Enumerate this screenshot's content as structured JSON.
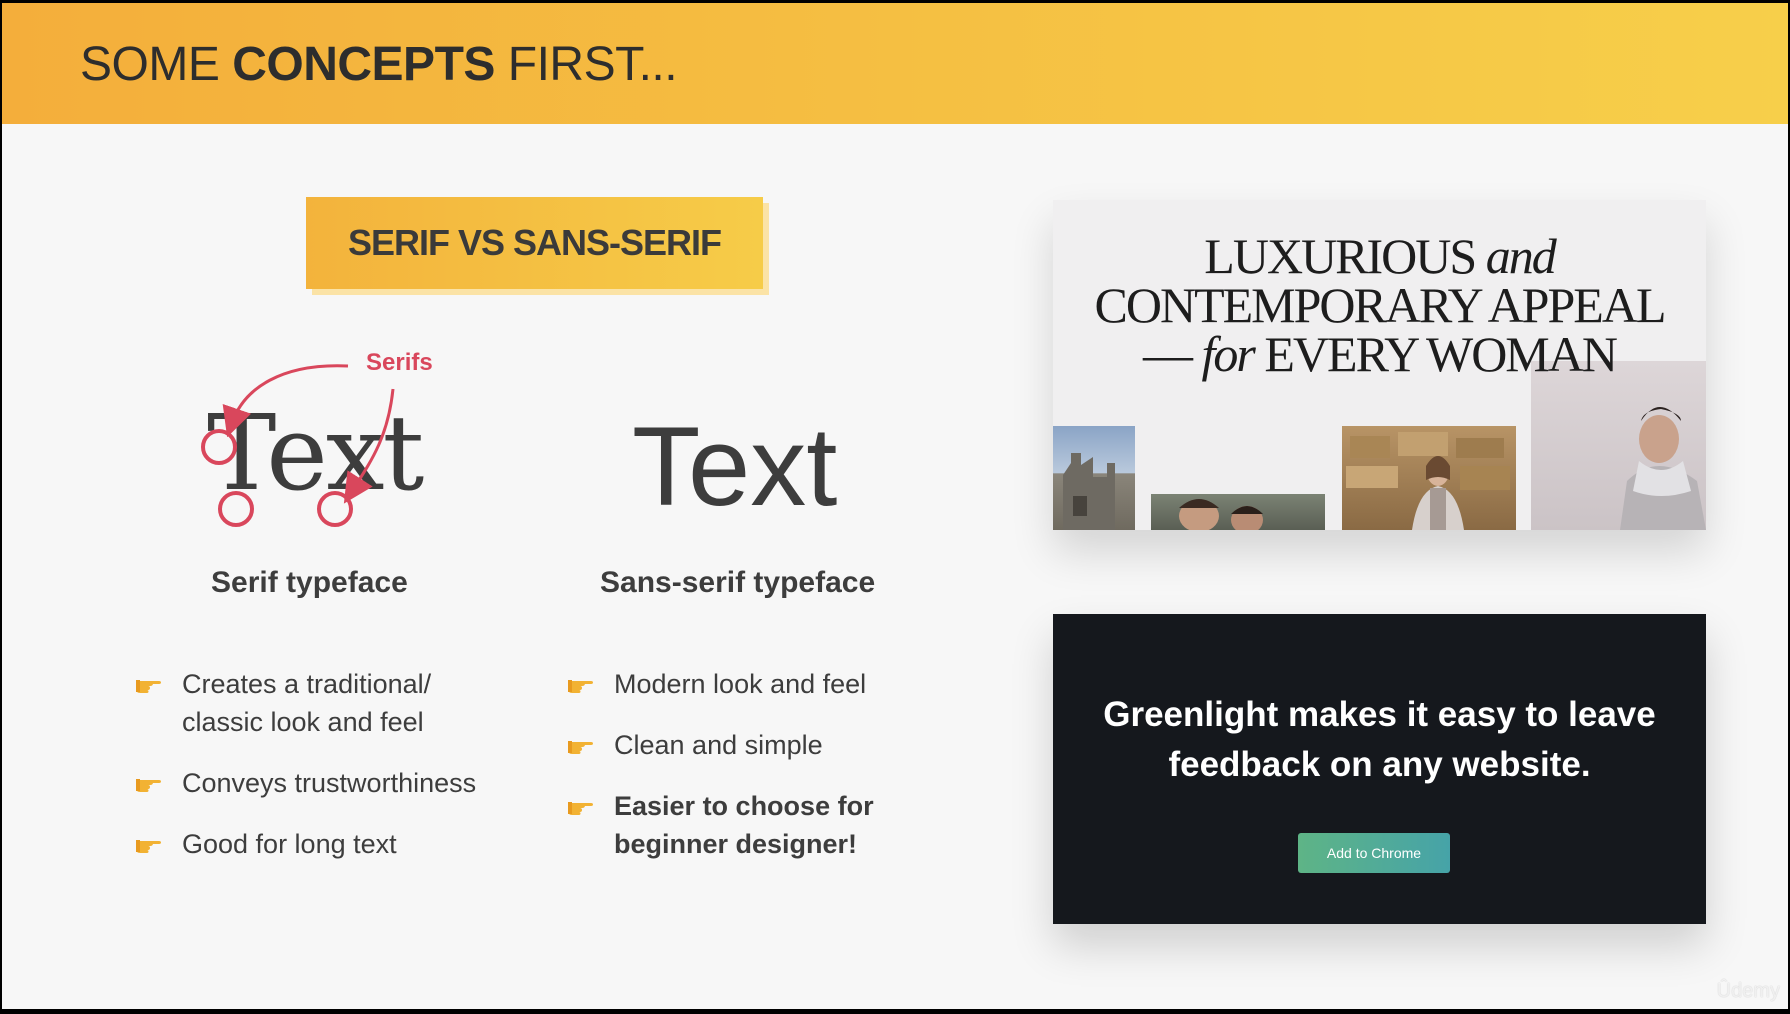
{
  "header": {
    "title_pre": "SOME",
    "title_bold": "CONCEPTS",
    "title_post": "FIRST..."
  },
  "section_label": "SERIF VS SANS-SERIF",
  "serif_column": {
    "annotation": "Serifs",
    "sample": "Text",
    "title": "Serif typeface",
    "bullets": [
      "Creates a traditional/ classic look and feel",
      "Conveys trustworthiness",
      "Good for long text"
    ]
  },
  "sans_column": {
    "sample": "Text",
    "title": "Sans-serif typeface",
    "bullets": [
      "Modern look and feel",
      "Clean and simple",
      "Easier to choose for beginner designer!"
    ]
  },
  "example_serif": {
    "line1_caps": "LUXURIOUS",
    "line1_italic": "and",
    "line2": "CONTEMPORARY APPEAL",
    "line3_dash": "—",
    "line3_italic": "for",
    "line3_caps": "EVERY WOMAN"
  },
  "example_sans": {
    "headline_line1": "Greenlight makes it easy to leave",
    "headline_line2": "feedback on any website.",
    "cta_label": "Add to Chrome"
  },
  "watermark": "Ûdemy",
  "colors": {
    "accent": "#f5bf42",
    "serif_marker": "#d9475c",
    "dark_card": "#15181d",
    "cta_start": "#5eb486",
    "cta_end": "#46a3a8"
  },
  "icons": {
    "bullet": "pointing-hand-icon"
  }
}
